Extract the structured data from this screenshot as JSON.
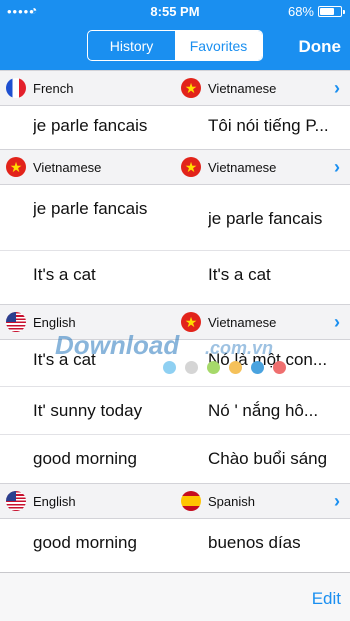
{
  "status": {
    "carrier": "•••••",
    "wifi_icon": "wifi-icon",
    "time": "8:55 PM",
    "battery": "68%",
    "battery_level": 0.68
  },
  "nav": {
    "tabs": [
      {
        "label": "History",
        "active": false
      },
      {
        "label": "Favorites",
        "active": true
      }
    ],
    "done_label": "Done"
  },
  "groups": [
    {
      "from": {
        "lang": "French",
        "flag": "flag-france-icon"
      },
      "to": {
        "lang": "Vietnamese",
        "flag": "flag-vietnam-icon"
      },
      "rows": [
        {
          "source": "je parle fancais",
          "target": "Tôi nói tiếng P..."
        }
      ]
    },
    {
      "from": {
        "lang": "Vietnamese",
        "flag": "flag-vietnam-icon"
      },
      "to": {
        "lang": "Vietnamese",
        "flag": "flag-vietnam-icon"
      },
      "rows": [
        {
          "source": "je parle fancais",
          "target": "je parle fancais"
        },
        {
          "source": "It's a cat",
          "target": "It's a cat"
        }
      ]
    },
    {
      "from": {
        "lang": "English",
        "flag": "flag-usa-icon"
      },
      "to": {
        "lang": "Vietnamese",
        "flag": "flag-vietnam-icon"
      },
      "rows": [
        {
          "source": "It's a cat",
          "target": "Nó là một con..."
        },
        {
          "source": "It' sunny today",
          "target": "Nó ' nắng hô..."
        },
        {
          "source": "good morning",
          "target": "Chào buổi sáng"
        }
      ]
    },
    {
      "from": {
        "lang": "English",
        "flag": "flag-usa-icon"
      },
      "to": {
        "lang": "Spanish",
        "flag": "flag-spain-icon"
      },
      "rows": [
        {
          "source": "good morning",
          "target": "buenos días"
        }
      ]
    }
  ],
  "watermark": {
    "brand": "Download",
    "domain": ".com.vn"
  },
  "toolbar": {
    "edit_label": "Edit"
  },
  "colors": {
    "accent": "#1a8ff0"
  }
}
